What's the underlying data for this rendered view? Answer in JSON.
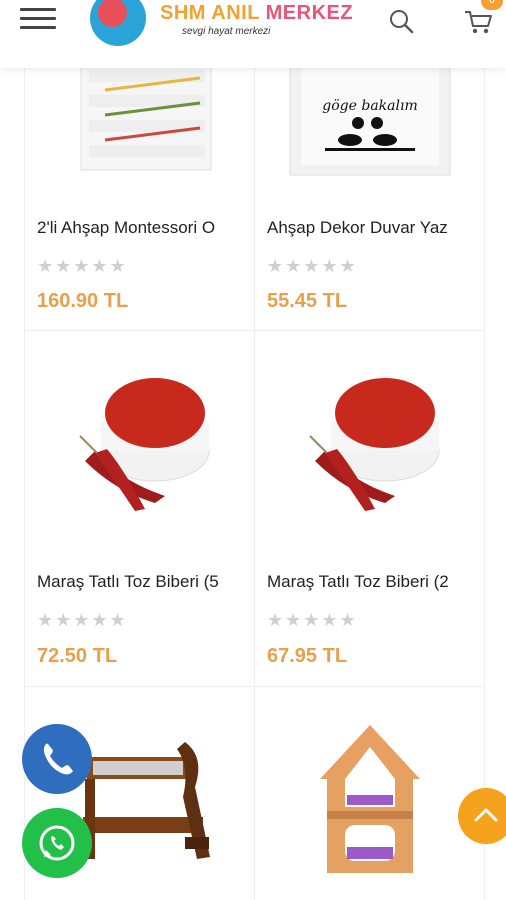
{
  "header": {
    "logo_part1": "SHM ANIL",
    "logo_part2": "MERKEZ",
    "logo_subtitle": "sevgi hayat merkezi",
    "cart_count": "0"
  },
  "products": [
    {
      "name": "2'li Ahşap Montessori O",
      "price": "160.90 TL",
      "stars": "★★★★★",
      "image": "wooden-shelf"
    },
    {
      "name": "Ahşap Dekor Duvar Yaz",
      "price": "55.45 TL",
      "stars": "★★★★★",
      "image": "wall-sign"
    },
    {
      "name": "Maraş Tatlı Toz Biberi (5",
      "price": "72.50 TL",
      "stars": "★★★★★",
      "image": "pepper-powder"
    },
    {
      "name": "Maraş Tatlı Toz Biberi (2",
      "price": "67.95 TL",
      "stars": "★★★★★",
      "image": "pepper-powder"
    },
    {
      "name": "",
      "price": "",
      "stars": "",
      "image": "wooden-bench"
    },
    {
      "name": "",
      "price": "",
      "stars": "",
      "image": "cat-house"
    }
  ],
  "sign_text": "göge bakalım",
  "colors": {
    "price": "#e9a04a",
    "call_button": "#2f6ebf",
    "whatsapp_button": "#22bf49",
    "scroll_top_button": "#f5a21c",
    "stars": "#cfcfcf"
  }
}
